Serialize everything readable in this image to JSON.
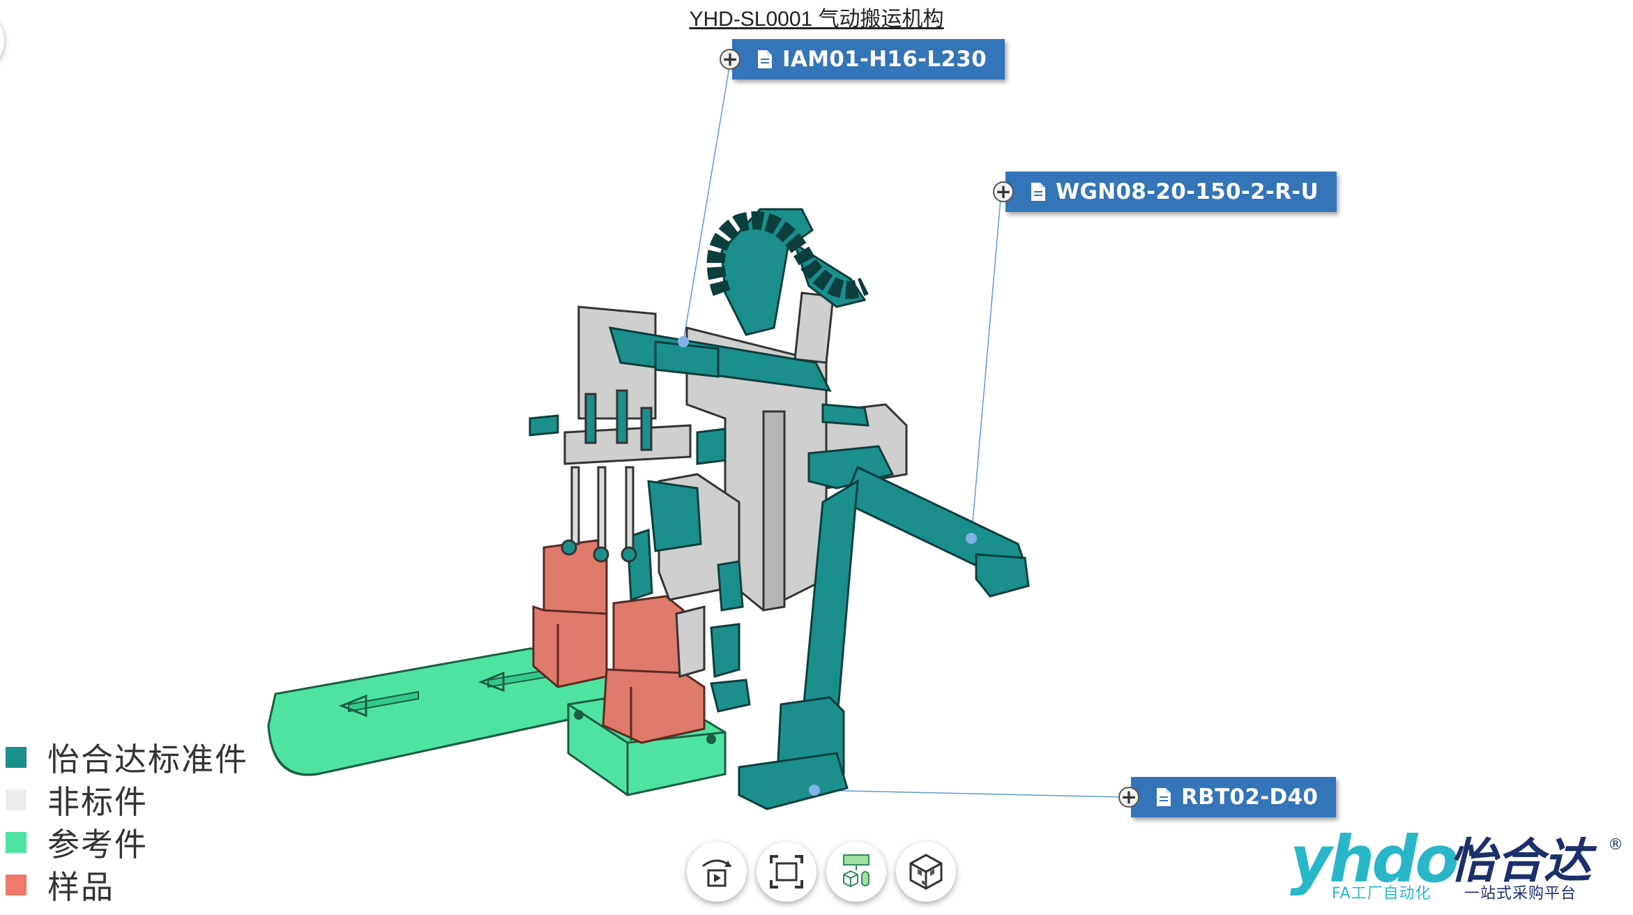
{
  "title": "YHD-SL0001 气动搬运机构",
  "callouts": [
    {
      "label": "IAM01-H16-L230",
      "icon": "document-icon",
      "expand_icon": "plus-circle-icon"
    },
    {
      "label": "WGN08-20-150-2-R-U",
      "icon": "document-icon",
      "expand_icon": "plus-circle-icon"
    },
    {
      "label": "RBT02-D40",
      "icon": "document-icon",
      "expand_icon": "plus-circle-icon"
    }
  ],
  "legend": [
    {
      "label": "怡合达标准件",
      "color": "#1a8f8c"
    },
    {
      "label": "非标件",
      "color": "#ececec"
    },
    {
      "label": "参考件",
      "color": "#4fe3a1"
    },
    {
      "label": "样品",
      "color": "#f07868"
    }
  ],
  "toolbar": [
    {
      "icon": "rotate-play-icon"
    },
    {
      "icon": "fit-view-icon"
    },
    {
      "icon": "assembly-tree-icon"
    },
    {
      "icon": "explode-view-icon"
    }
  ],
  "logo": {
    "text": "怡合达",
    "tagline": "FA工厂自动化  一站式采购平台",
    "mark": "yhdo"
  },
  "colors": {
    "standard": "#1a8f8c",
    "nonstandard": "#c8c8c8",
    "reference": "#4fe3a1",
    "sample": "#e07a6a",
    "callout": "#3474b8"
  }
}
